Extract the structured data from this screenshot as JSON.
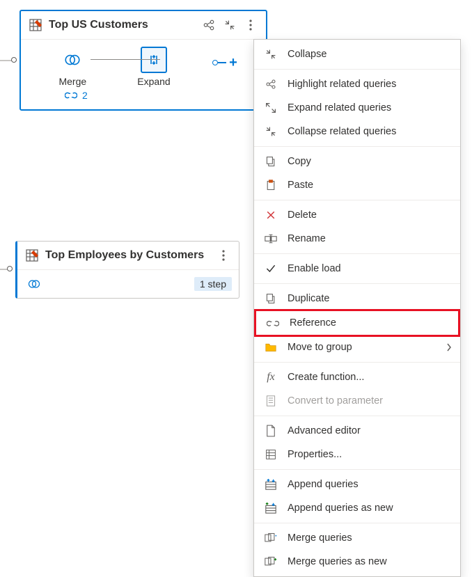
{
  "node1": {
    "title": "Top US Customers",
    "step1_label": "Merge",
    "step2_label": "Expand",
    "link_count": "2"
  },
  "node2": {
    "title": "Top Employees by Customers",
    "steps_label": "1 step"
  },
  "menu": {
    "collapse": "Collapse",
    "highlight_related": "Highlight related queries",
    "expand_related": "Expand related queries",
    "collapse_related": "Collapse related queries",
    "copy": "Copy",
    "paste": "Paste",
    "delete": "Delete",
    "rename": "Rename",
    "enable_load": "Enable load",
    "duplicate": "Duplicate",
    "reference": "Reference",
    "move_to_group": "Move to group",
    "create_function": "Create function...",
    "convert_to_parameter": "Convert to parameter",
    "advanced_editor": "Advanced editor",
    "properties": "Properties...",
    "append_queries": "Append queries",
    "append_queries_as_new": "Append queries as new",
    "merge_queries": "Merge queries",
    "merge_queries_as_new": "Merge queries as new"
  }
}
